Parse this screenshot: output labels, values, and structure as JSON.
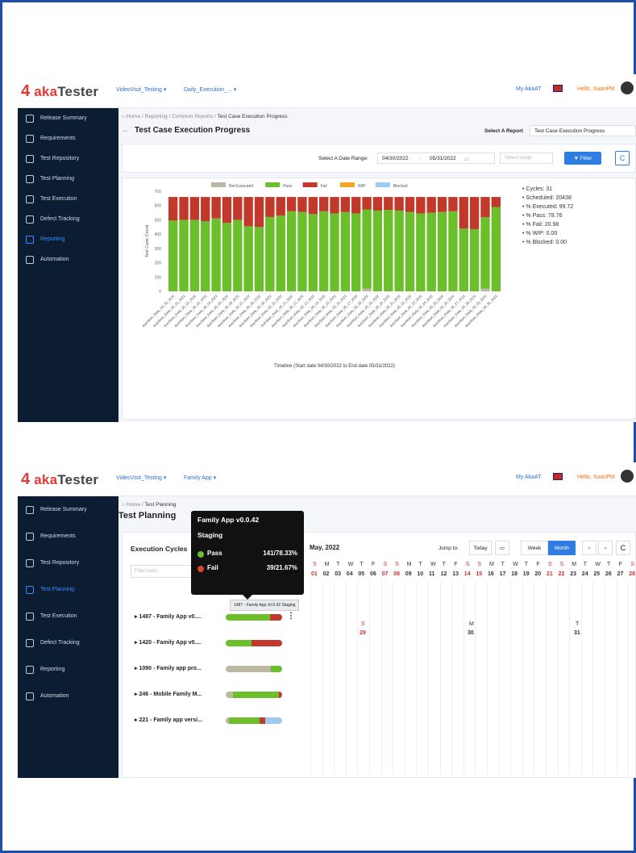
{
  "screen1": {
    "logo": {
      "prefix": "aka",
      "suffix": "Tester"
    },
    "project_select": "VideoVisit_Testing ▾",
    "plan_select": "Daily_Execution_... ▾",
    "my_aka": "My AkaAT",
    "hello": "Hello, XuanPM",
    "sidebar": [
      {
        "label": "Release Summary",
        "icon": "document-icon",
        "active": false
      },
      {
        "label": "Requirements",
        "icon": "edit-icon",
        "active": false
      },
      {
        "label": "Test Repository",
        "icon": "repository-icon",
        "active": false
      },
      {
        "label": "Test Planning",
        "icon": "calendar-icon",
        "active": false
      },
      {
        "label": "Test Execution",
        "icon": "clipboard-icon",
        "active": false
      },
      {
        "label": "Defect Tracking",
        "icon": "bug-icon",
        "active": false
      },
      {
        "label": "Reporting",
        "icon": "chart-icon",
        "active": true
      },
      {
        "label": "Automation",
        "icon": "automation-icon",
        "active": false
      }
    ],
    "breadcrumb": {
      "home": "⌂ Home",
      "sep": "/",
      "reporting": "Reporting",
      "common": "Common Reports",
      "current": "Test Case Execution Progress"
    },
    "page_title": "Test Case Execution Progress",
    "select_report_label": "Select A Report",
    "select_report_value": "Test Case Execution Progress",
    "date_range_label": "Select A Date Range:",
    "date_from": "04/30/2022",
    "date_to": "05/31/2022",
    "select_range_placeholder": "Select range",
    "filter_label": "Filter",
    "stats": [
      "• Cycles: 31",
      "• Scheduled: 20438",
      "• % Executed: 99.72",
      "• % Pass: 78.76",
      "• % Fail: 20.98",
      "• % WIP: 0.00",
      "• % Blocked: 0.00"
    ],
    "colors": {
      "pass": "#6abf2a",
      "fail": "#c0392b",
      "not_executed": "#bdb6a3",
      "wip": "#f5a623",
      "blocked": "#9ec9f0"
    }
  },
  "chart_data": {
    "type": "bar",
    "stacked": true,
    "title": "",
    "xlabel": "Timeline (Start date 04/30/2022 to End date 05/31/2022)",
    "ylabel": "Test Case Count",
    "ylim": [
      0,
      700
    ],
    "yticks": [
      0,
      100,
      200,
      300,
      400,
      500,
      600,
      700
    ],
    "legend": [
      "Not Executed",
      "Pass",
      "Fail",
      "WIP",
      "Blocked"
    ],
    "categories": [
      "AutoStart_Daily_04_30_2022",
      "AutoStart_Daily_05_01_2022",
      "AutoStart_Daily_05_02_2022",
      "AutoStart_Daily_05_03_2022",
      "AutoStart_Daily_05_04_2022",
      "AutoStart_Daily_05_05_2022",
      "AutoStart_Daily_05_06_2022",
      "AutoStart_Daily_05_07_2022",
      "AutoStart_Daily_05_08_2022",
      "AutoStart_Daily_05_09_2022",
      "AutoStart_Daily_05_10_2022",
      "AutoStart_Daily_05_11_2022",
      "AutoStart_Daily_05_12_2022",
      "AutoStart_Daily_05_13_2022",
      "AutoStart_Daily_05_14_2022",
      "AutoStart_Daily_05_15_2022",
      "AutoStart_Daily_05_16_2022",
      "AutoStart_Daily_05_17_2022",
      "AutoStart_Daily_05_18_2022",
      "AutoStart_Daily_05_19_2022",
      "AutoStart_Daily_05_20_2022",
      "AutoStart_Daily_05_21_2022",
      "AutoStart_Daily_05_22_2022",
      "AutoStart_Daily_05_23_2022",
      "AutoStart_Daily_05_24_2022",
      "AutoStart_Daily_05_25_2022",
      "AutoStart_Daily_05_26_2022",
      "AutoStart_Daily_05_27_2022",
      "AutoStart_Daily_05_28_2022",
      "AutoStart_Daily_05_29_2022",
      "AutoStart_Daily_05_30_2022"
    ],
    "series": [
      {
        "name": "Not Executed",
        "values": [
          0,
          0,
          0,
          0,
          0,
          0,
          0,
          0,
          0,
          0,
          0,
          0,
          0,
          0,
          0,
          0,
          0,
          0,
          18,
          0,
          0,
          0,
          0,
          0,
          0,
          0,
          0,
          0,
          0,
          18,
          0
        ]
      },
      {
        "name": "Pass",
        "values": [
          495,
          500,
          500,
          490,
          510,
          480,
          500,
          455,
          450,
          520,
          530,
          560,
          555,
          540,
          560,
          545,
          555,
          545,
          555,
          565,
          570,
          565,
          555,
          545,
          550,
          555,
          560,
          440,
          435,
          500,
          590
        ]
      },
      {
        "name": "Fail",
        "values": [
          165,
          160,
          160,
          170,
          150,
          180,
          160,
          205,
          210,
          140,
          130,
          100,
          105,
          120,
          100,
          115,
          105,
          115,
          87,
          95,
          90,
          95,
          105,
          115,
          110,
          105,
          100,
          220,
          225,
          142,
          70
        ]
      },
      {
        "name": "WIP",
        "values": [
          0,
          0,
          0,
          0,
          0,
          0,
          0,
          0,
          0,
          0,
          0,
          0,
          0,
          0,
          0,
          0,
          0,
          0,
          0,
          0,
          0,
          0,
          0,
          0,
          0,
          0,
          0,
          0,
          0,
          0,
          0
        ]
      },
      {
        "name": "Blocked",
        "values": [
          0,
          0,
          0,
          0,
          0,
          0,
          0,
          0,
          0,
          0,
          0,
          0,
          0,
          0,
          0,
          0,
          0,
          0,
          0,
          0,
          0,
          0,
          0,
          0,
          0,
          0,
          0,
          0,
          0,
          0,
          0
        ]
      }
    ]
  },
  "screen2": {
    "project_select": "VideoVisit_Testing ▾",
    "plan_select": "Family App ▾",
    "my_aka": "My AkaAT",
    "hello": "Hello, XuanPM",
    "sidebar": [
      {
        "label": "Release Summary",
        "icon": "document-icon",
        "active": false
      },
      {
        "label": "Requirements",
        "icon": "edit-icon",
        "active": false
      },
      {
        "label": "Test Repository",
        "icon": "repository-icon",
        "active": false
      },
      {
        "label": "Test Planning",
        "icon": "calendar-icon",
        "active": true
      },
      {
        "label": "Test Execution",
        "icon": "clipboard-icon",
        "active": false
      },
      {
        "label": "Defect Tracking",
        "icon": "bug-icon",
        "active": false
      },
      {
        "label": "Reporting",
        "icon": "chart-icon",
        "active": false
      },
      {
        "label": "Automation",
        "icon": "automation-icon",
        "active": false
      }
    ],
    "breadcrumb": {
      "home": "⌂ Home",
      "sep": "/",
      "current": "Test Planning"
    },
    "page_title": "Test Planning",
    "execution_cycles": "Execution Cycles",
    "filter_placeholder": "Filter tasks",
    "month": "May, 2022",
    "jump_to": "Jump to:",
    "today": "Today",
    "week": "Week",
    "month_btn": "Month",
    "nav_prev": "«",
    "nav_next": "»",
    "tooltip": {
      "title": "Family App v0.0.42",
      "subtitle": "Staging",
      "pass_label": "Pass",
      "pass_value": "141/78.33%",
      "fail_label": "Fail",
      "fail_value": "39/21.67%"
    },
    "hover_caption": "1487 - Family App v0.0.42 Staging",
    "day_letters": [
      "S",
      "M",
      "T",
      "W",
      "T",
      "F",
      "S",
      "S",
      "M",
      "T",
      "W",
      "T",
      "F",
      "S",
      "S",
      "M",
      "T",
      "W",
      "T",
      "F",
      "S",
      "S",
      "M",
      "T",
      "W",
      "T",
      "F",
      "S"
    ],
    "day_numbers": [
      "01",
      "02",
      "03",
      "04",
      "05",
      "06",
      "07",
      "08",
      "09",
      "10",
      "11",
      "12",
      "13",
      "14",
      "15",
      "16",
      "17",
      "18",
      "19",
      "20",
      "21",
      "22",
      "23",
      "24",
      "25",
      "26",
      "27",
      "28"
    ],
    "markers": [
      {
        "letter": "S",
        "day": "29"
      },
      {
        "letter": "M",
        "day": "30"
      },
      {
        "letter": "T",
        "day": "31"
      }
    ],
    "cycles": [
      {
        "label": "1487 - Family App v0....",
        "pass": 0.78,
        "fail": 0.22,
        "not_executed": 0,
        "blocked": 0
      },
      {
        "label": "1420 - Family App v0....",
        "pass": 0.45,
        "fail": 0.55,
        "not_executed": 0,
        "blocked": 0
      },
      {
        "label": "1090 - Family app pro...",
        "pass": 0.2,
        "fail": 0,
        "not_executed": 0.8,
        "blocked": 0
      },
      {
        "label": "246 - Mobile Family M...",
        "pass": 0.82,
        "fail": 0.05,
        "not_executed": 0.13,
        "blocked": 0
      },
      {
        "label": "221 - Family app versi...",
        "pass": 0.55,
        "fail": 0.1,
        "not_executed": 0.05,
        "blocked": 0.3
      }
    ]
  }
}
